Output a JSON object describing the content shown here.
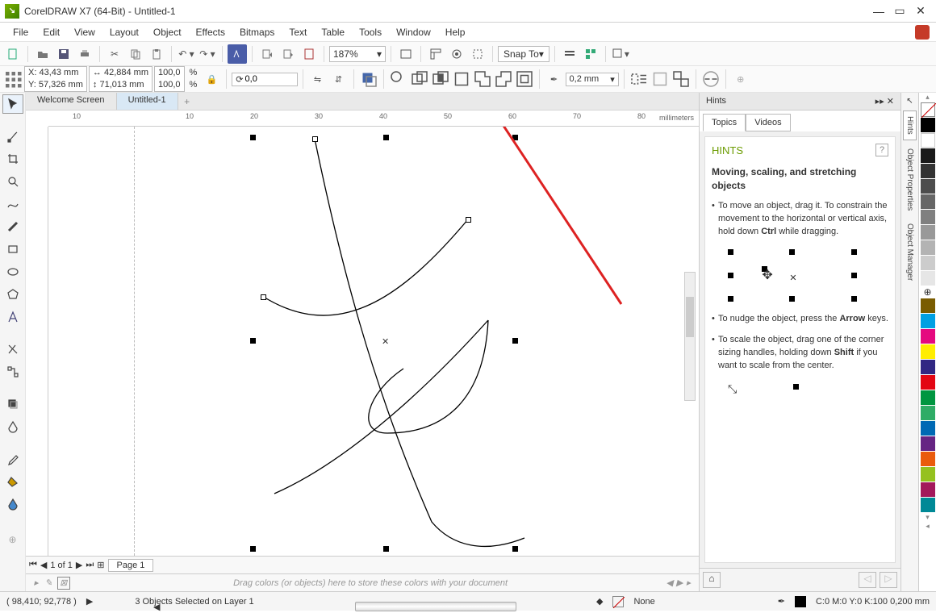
{
  "title": "CorelDRAW X7 (64-Bit) - Untitled-1",
  "menu": [
    "File",
    "Edit",
    "View",
    "Layout",
    "Object",
    "Effects",
    "Bitmaps",
    "Text",
    "Table",
    "Tools",
    "Window",
    "Help"
  ],
  "toolbar": {
    "zoom": "187%",
    "snap": "Snap To"
  },
  "properties": {
    "x_label": "X:",
    "x": "43,43 mm",
    "y_label": "Y:",
    "y": "57,326 mm",
    "w": "42,884 mm",
    "h": "71,013 mm",
    "sx": "100,0",
    "sy": "100,0",
    "pct": "%",
    "rot": "0,0",
    "outline_width": "0,2 mm"
  },
  "tabs": {
    "welcome": "Welcome Screen",
    "doc": "Untitled-1"
  },
  "ruler_unit": "millimeters",
  "ruler_ticks": [
    "10",
    "10",
    "20",
    "30",
    "40",
    "50",
    "60",
    "70",
    "80"
  ],
  "nav": {
    "page_info": "1 of 1",
    "page_tab": "Page 1"
  },
  "dragstrip": "Drag colors (or objects) here to store these colors with your document",
  "hints": {
    "panel_title": "Hints",
    "tabs": [
      "Topics",
      "Videos"
    ],
    "heading": "HINTS",
    "subheading": "Moving, scaling, and stretching objects",
    "tip1_a": "To move an object, drag it. To constrain the movement to the horizontal or vertical axis, hold down ",
    "tip1_b": "Ctrl",
    "tip1_c": " while dragging.",
    "tip2_a": "To nudge the object, press the ",
    "tip2_b": "Arrow",
    "tip2_c": " keys.",
    "tip3_a": "To scale the object, drag one of the corner sizing handles, holding down ",
    "tip3_b": "Shift",
    "tip3_c": " if you want to scale from the center."
  },
  "side_tabs": [
    "Hints",
    "Object Properties",
    "Object Manager"
  ],
  "palette": [
    "#000000",
    "#ffffff",
    "#e0e0e0",
    "#a0a0a0",
    "#606060",
    "#303030",
    "#7a0f16",
    "#a01820",
    "#d42a30",
    "#ff6600",
    "#ffcc00",
    "#ffff66",
    "#80d020",
    "#009933",
    "#00aaaa",
    "#0066cc",
    "#003399",
    "#663399",
    "#9933cc",
    "#cc3399",
    "#ff66cc"
  ],
  "status": {
    "cursor": "( 98,410; 92,778 )",
    "selection": "3 Objects Selected on Layer 1",
    "fill": "None",
    "outline": "C:0 M:0 Y:0 K:100  0,200 mm"
  }
}
